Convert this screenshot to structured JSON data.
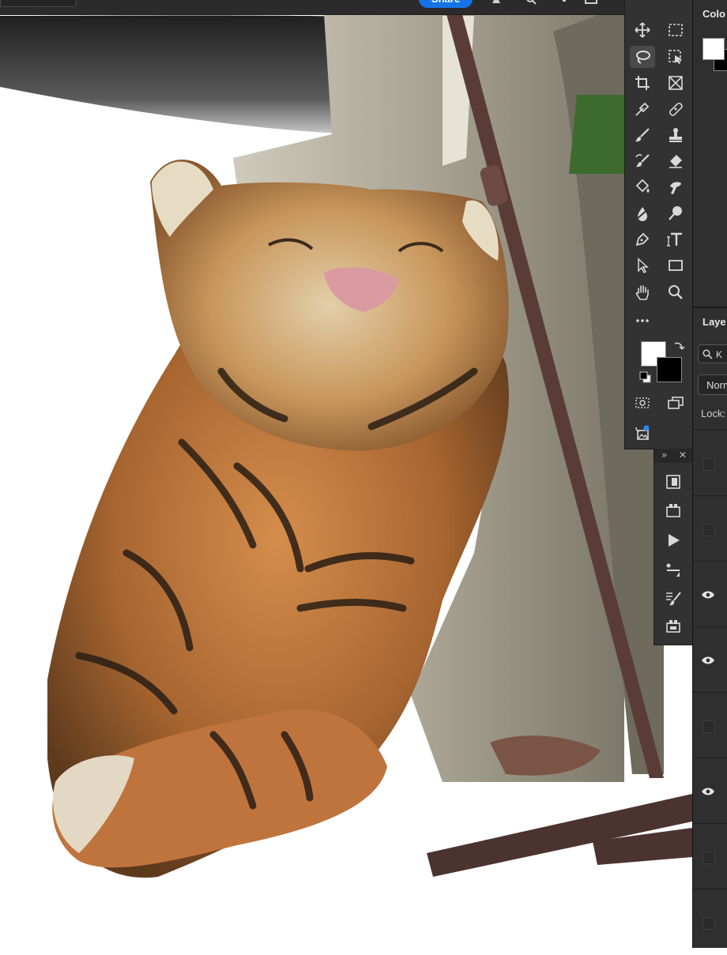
{
  "app": {
    "share_label": "Share"
  },
  "tools": [
    {
      "name": "move-tool",
      "icon": "move-icon"
    },
    {
      "name": "marquee-tool",
      "icon": "rect-marquee-icon"
    },
    {
      "name": "lasso-tool",
      "icon": "lasso-icon",
      "active": true
    },
    {
      "name": "object-select-tool",
      "icon": "object-select-icon"
    },
    {
      "name": "crop-tool",
      "icon": "crop-icon"
    },
    {
      "name": "frame-tool",
      "icon": "frame-icon"
    },
    {
      "name": "eyedropper-tool",
      "icon": "eyedropper-icon"
    },
    {
      "name": "healing-brush-tool",
      "icon": "bandage-icon"
    },
    {
      "name": "brush-tool",
      "icon": "brush-icon"
    },
    {
      "name": "clone-stamp-tool",
      "icon": "stamp-icon"
    },
    {
      "name": "history-brush-tool",
      "icon": "history-brush-icon"
    },
    {
      "name": "eraser-tool",
      "icon": "eraser-icon"
    },
    {
      "name": "paint-bucket-tool",
      "icon": "bucket-icon"
    },
    {
      "name": "smudge-tool",
      "icon": "smudge-icon"
    },
    {
      "name": "blur-tool",
      "icon": "blur-icon"
    },
    {
      "name": "dodge-tool",
      "icon": "dodge-icon"
    },
    {
      "name": "pen-tool",
      "icon": "pen-icon"
    },
    {
      "name": "type-tool",
      "icon": "type-icon"
    },
    {
      "name": "path-select-tool",
      "icon": "arrow-icon"
    },
    {
      "name": "rectangle-tool",
      "icon": "rectangle-icon"
    },
    {
      "name": "hand-tool",
      "icon": "hand-icon"
    },
    {
      "name": "zoom-tool",
      "icon": "zoom-icon"
    },
    {
      "name": "more-tools",
      "icon": "ellipsis-icon"
    }
  ],
  "colors": {
    "foreground": "#ffffff",
    "background": "#000000",
    "accent": "#1473e6",
    "panel": "#323232"
  },
  "strip": {
    "expand_glyph": "»",
    "close_glyph": "✕",
    "buttons": [
      "history-icon",
      "layer-comps-icon",
      "play-icon",
      "brush-settings-icon",
      "brush-presets-icon",
      "properties-icon"
    ]
  },
  "color_panel": {
    "title": "Colo"
  },
  "layers_panel": {
    "title": "Laye",
    "search_value": "K",
    "blend_mode": "Norm",
    "lock_label": "Lock:",
    "rows": [
      {
        "visible": false
      },
      {
        "visible": false
      },
      {
        "visible": true
      },
      {
        "visible": true
      },
      {
        "visible": false
      },
      {
        "visible": true
      },
      {
        "visible": false
      },
      {
        "visible": false
      }
    ]
  }
}
